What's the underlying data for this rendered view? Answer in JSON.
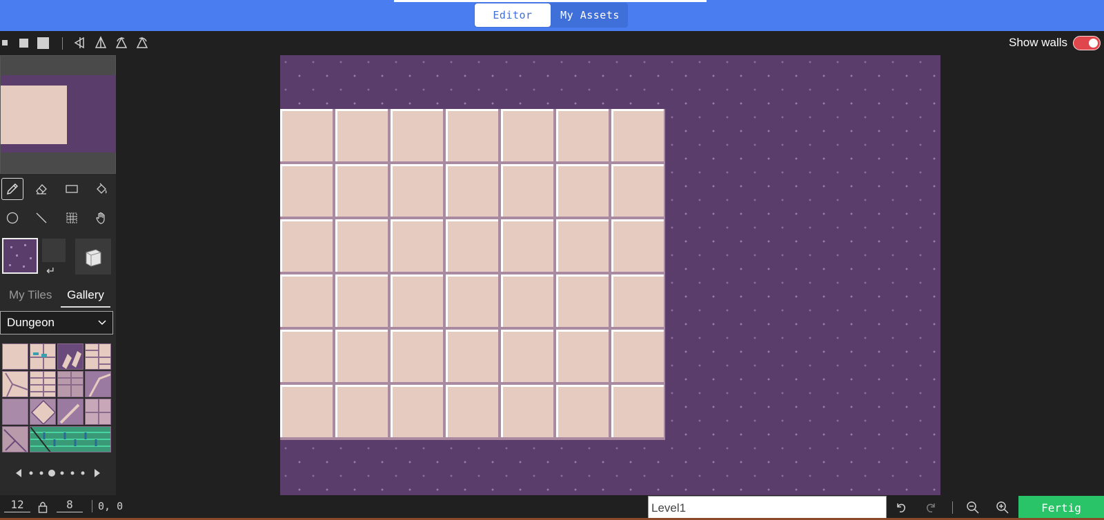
{
  "header": {
    "tabs": [
      {
        "label": "Editor",
        "active": true
      },
      {
        "label": "My Assets",
        "active": false
      }
    ],
    "accent_color": "#4a7ef0"
  },
  "toolbar": {
    "brush_sizes": [
      "brush-size-small",
      "brush-size-medium",
      "brush-size-large"
    ],
    "mirror_icons": [
      "flip-horizontal-icon",
      "flip-vertical-icon",
      "rotate-icon",
      "rotate-ccw-icon"
    ],
    "show_walls_label": "Show walls",
    "show_walls_on": true
  },
  "tools": {
    "items": [
      "pencil-icon",
      "eraser-icon",
      "rectangle-icon",
      "fill-bucket-icon",
      "circle-icon",
      "line-icon",
      "grid-select-icon",
      "hand-icon"
    ],
    "active": "pencil"
  },
  "palette": {
    "tabs": [
      {
        "label": "My Tiles",
        "active": false
      },
      {
        "label": "Gallery",
        "active": true
      }
    ],
    "category": "Dungeon",
    "pager_pages": 6,
    "pager_current": 3
  },
  "statusbar": {
    "width": "12",
    "height": "8",
    "cursor": "0, 0",
    "level_name": "Level1",
    "done_label": "Fertig",
    "done_color": "#29c368"
  }
}
